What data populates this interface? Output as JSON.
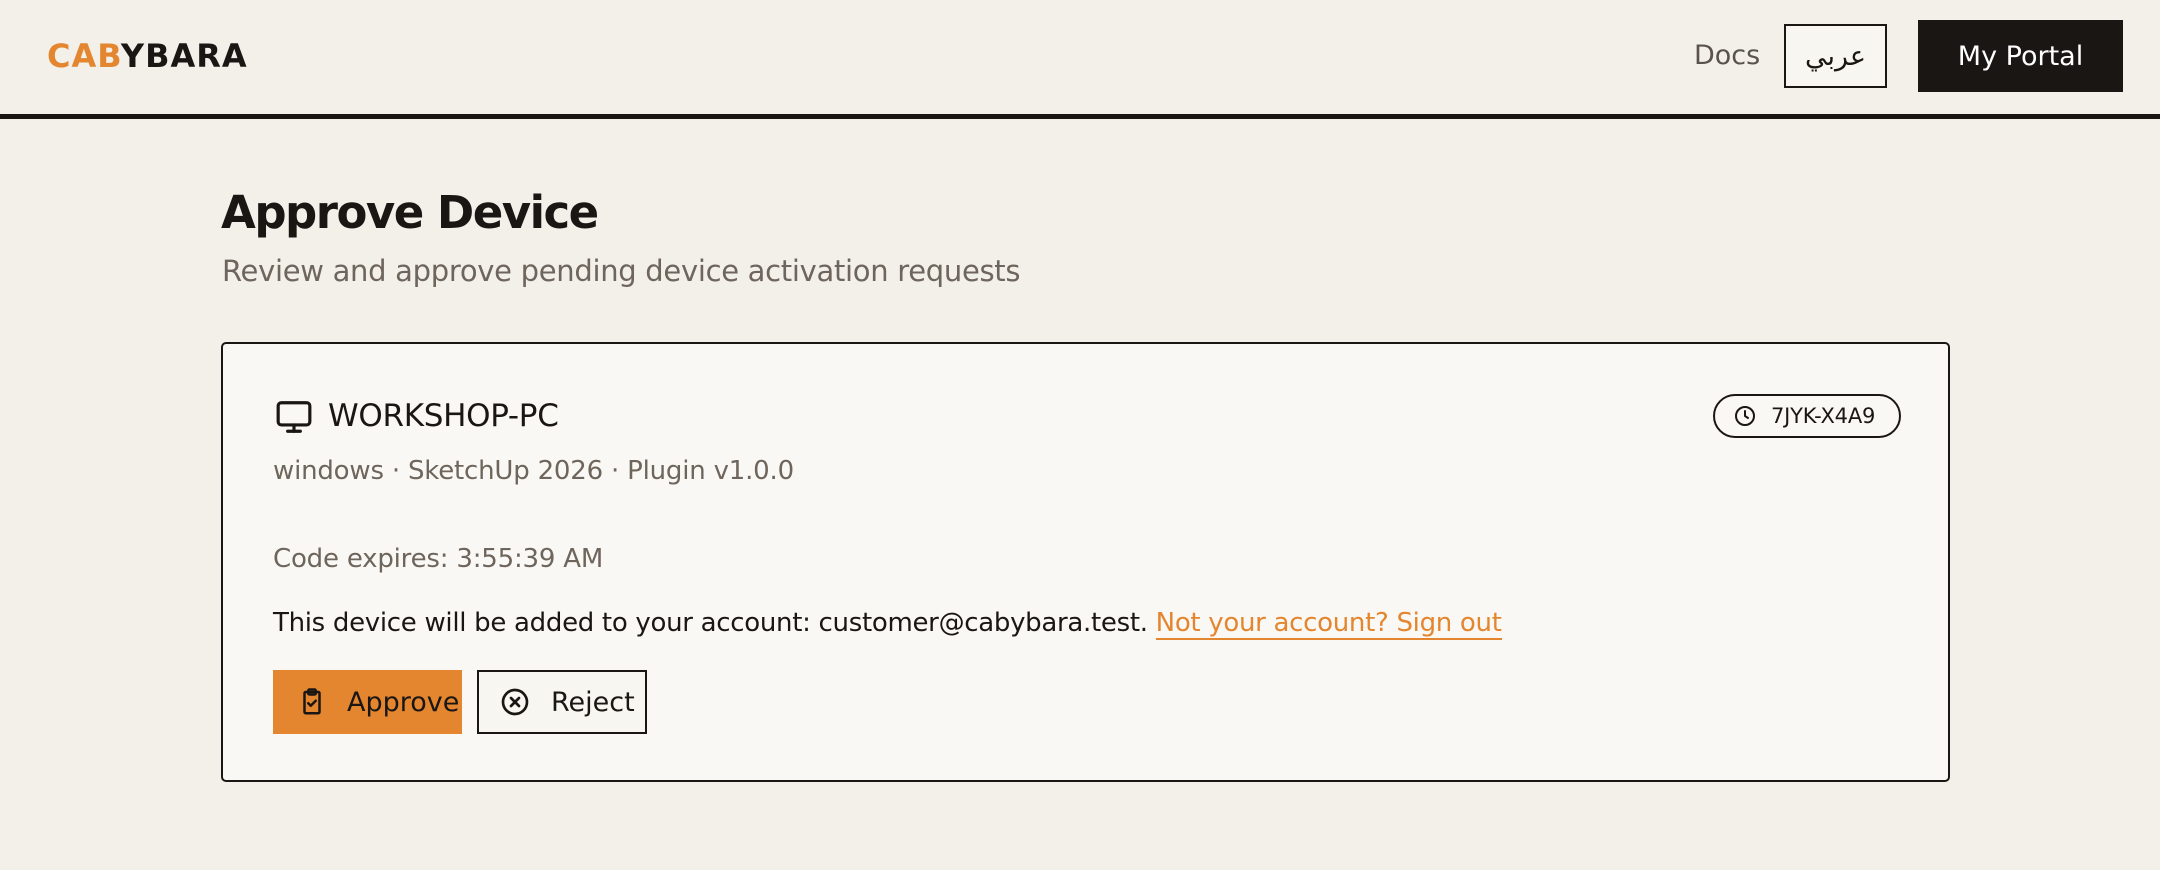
{
  "header": {
    "logo_accent": "CAB",
    "logo_rest": "YBARA",
    "docs_label": "Docs",
    "language_label": "عربي",
    "portal_label": "My Portal"
  },
  "page": {
    "title": "Approve Device",
    "subtitle": "Review and approve pending device activation requests"
  },
  "device": {
    "icon": "monitor-icon",
    "name": "WORKSHOP-PC",
    "code": "7JYK-X4A9",
    "code_icon": "clock-icon",
    "meta": "windows · SketchUp 2026 · Plugin v1.0.0",
    "expires": "Code expires: 3:55:39 AM",
    "account_text": "This device will be added to your account: customer@cabybara.test. ",
    "signout_label": "Not your account? Sign out"
  },
  "actions": {
    "approve_label": "Approve",
    "approve_icon": "clipboard-check-icon",
    "reject_label": "Reject",
    "reject_icon": "x-circle-icon"
  },
  "colors": {
    "accent": "#e3862f",
    "dark": "#1a1614",
    "background": "#f3f0e9",
    "muted_text": "#6e655c"
  }
}
